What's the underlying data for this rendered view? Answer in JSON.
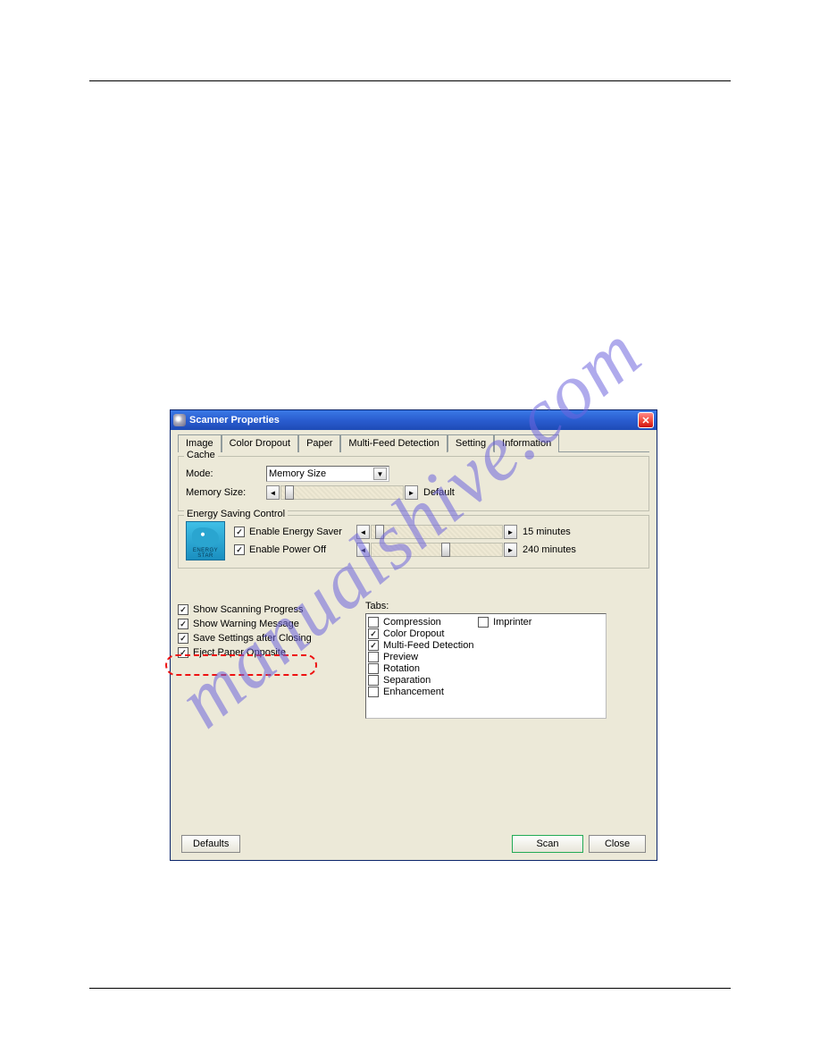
{
  "watermark": "manualshive.com",
  "window": {
    "title": "Scanner Properties",
    "tabs": [
      "Image",
      "Color Dropout",
      "Paper",
      "Multi-Feed Detection",
      "Setting",
      "Information"
    ],
    "activeTab": "Setting",
    "cache": {
      "groupTitle": "Cache",
      "modeLabel": "Mode:",
      "modeValue": "Memory Size",
      "memLabel": "Memory Size:",
      "defaultText": "Default"
    },
    "energy": {
      "groupTitle": "Energy Saving Control",
      "iconCaption": "ENERGY STAR",
      "enableSaver": "Enable Energy Saver",
      "enablePowerOff": "Enable Power Off",
      "saverValue": "15 minutes",
      "powerOffValue": "240 minutes"
    },
    "leftChecks": [
      {
        "label": "Show Scanning Progress",
        "checked": true
      },
      {
        "label": "Show Warning Message",
        "checked": true
      },
      {
        "label": "Save Settings after Closing",
        "checked": true
      },
      {
        "label": "Eject Paper Opposite",
        "checked": true
      }
    ],
    "tabsPanel": {
      "label": "Tabs:",
      "items": [
        {
          "label": "Compression",
          "checked": false
        },
        {
          "label": "Color Dropout",
          "checked": true
        },
        {
          "label": "Multi-Feed Detection",
          "checked": true
        },
        {
          "label": "Preview",
          "checked": false
        },
        {
          "label": "Rotation",
          "checked": false
        },
        {
          "label": "Separation",
          "checked": false
        },
        {
          "label": "Enhancement",
          "checked": false
        }
      ],
      "imprinter": {
        "label": "Imprinter",
        "checked": false
      }
    },
    "buttons": {
      "defaults": "Defaults",
      "scan": "Scan",
      "close": "Close"
    }
  }
}
